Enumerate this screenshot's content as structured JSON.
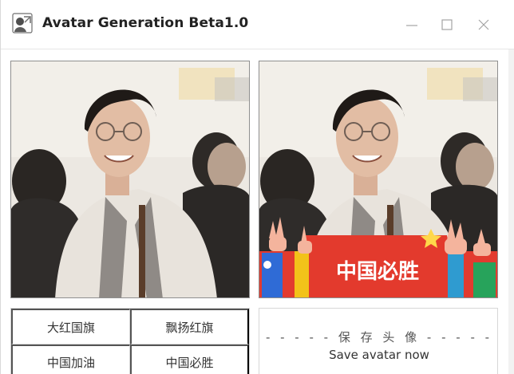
{
  "window": {
    "title": "Avatar Generation Beta1.0",
    "controls": [
      "minimize-icon",
      "maximize-icon",
      "close-icon"
    ]
  },
  "panels": {
    "original_photo": "original",
    "preview_photo": "preview",
    "overlay_banner_text": "中国必胜"
  },
  "frame_buttons": [
    {
      "label": "大红国旗"
    },
    {
      "label": "飘扬红旗"
    },
    {
      "label": "中国加油"
    },
    {
      "label": "中国必胜"
    }
  ],
  "save": {
    "title": "- - - - -  保 存 头 像  - - - - -",
    "subtitle": "Save avatar now"
  },
  "colors": {
    "banner_red": "#e23b2f",
    "banner_text": "#ffffff",
    "border": "#d7d7d7"
  }
}
